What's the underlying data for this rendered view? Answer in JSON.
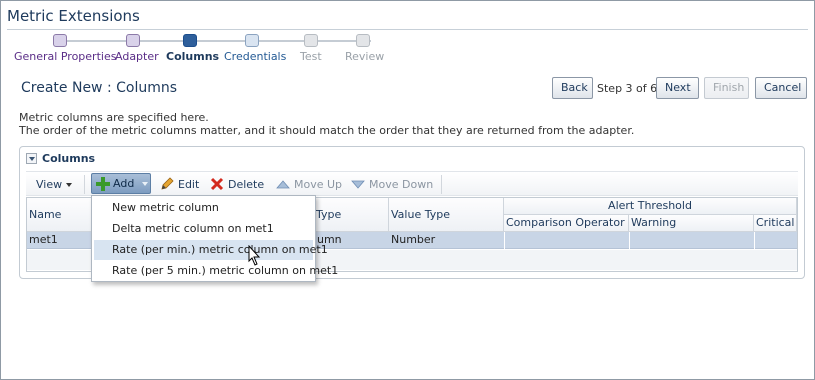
{
  "app": {
    "title": "Metric Extensions"
  },
  "train": {
    "steps": [
      {
        "label": "General Properties",
        "state": "visited"
      },
      {
        "label": "Adapter",
        "state": "visited"
      },
      {
        "label": "Columns",
        "state": "current"
      },
      {
        "label": "Credentials",
        "state": "next"
      },
      {
        "label": "Test",
        "state": "disabled"
      },
      {
        "label": "Review",
        "state": "disabled"
      }
    ]
  },
  "page": {
    "title": "Create New : Columns",
    "description_line1": "Metric columns are specified here.",
    "description_line2": "The order of the metric columns matter, and it should match the order that they are returned from the adapter."
  },
  "nav": {
    "back_label": "Back",
    "step_text": "Step 3 of 6",
    "next_label": "Next",
    "finish_label": "Finish",
    "cancel_label": "Cancel"
  },
  "panel": {
    "title": "Columns",
    "toolbar": {
      "view_label": "View",
      "add_label": "Add",
      "edit_label": "Edit",
      "delete_label": "Delete",
      "move_up_label": "Move Up",
      "move_down_label": "Move Down"
    },
    "table": {
      "columns": [
        "Name",
        "Type",
        "Value Type"
      ],
      "group_header": "Alert Threshold",
      "sub_columns": [
        "Comparison Operator",
        "Warning",
        "Critical"
      ],
      "rows": [
        {
          "name": "met1",
          "type": "umn",
          "value_type": "Number"
        }
      ]
    }
  },
  "menu": {
    "items": [
      "New metric column",
      "Delta metric column on met1",
      "Rate (per min.) metric column on met1",
      "Rate (per 5 min.) metric column on met1"
    ],
    "hovered_index": 2
  },
  "colors": {
    "brand_text": "#1e3a5c",
    "selected_row": "#c8d5e6",
    "menu_hover": "#d8e4f1",
    "add_icon": "#3a9a2a",
    "delete_icon": "#d32a1e"
  }
}
